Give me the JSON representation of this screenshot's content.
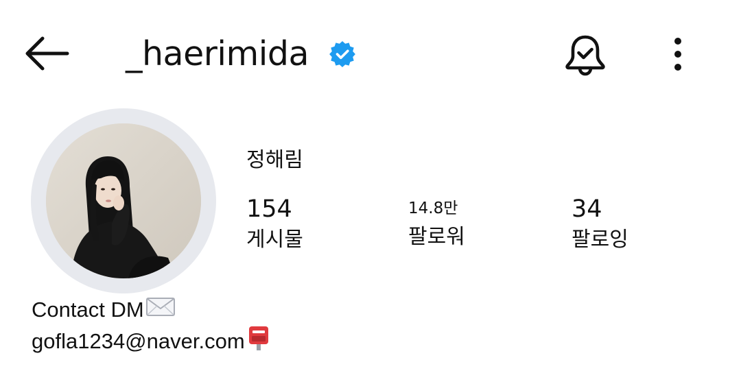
{
  "header": {
    "username": "_haerimida",
    "verified": true,
    "icons": {
      "back": "back-arrow-icon",
      "verified": "verified-badge-icon",
      "notifications": "notification-bell-check-icon",
      "more": "more-vertical-icon"
    }
  },
  "profile": {
    "display_name": "정해림",
    "avatar": "profile-photo"
  },
  "stats": {
    "posts": {
      "count": "154",
      "label": "게시물"
    },
    "followers": {
      "count": "14.8만",
      "label": "팔로워"
    },
    "following": {
      "count": "34",
      "label": "팔로잉"
    }
  },
  "bio": {
    "line1": "Contact DM",
    "line1_emoji": "envelope-icon",
    "line2": "gofla1234@naver.com",
    "line2_emoji": "postbox-icon"
  },
  "colors": {
    "verified": "#1d9bf0",
    "avatar_ring": "#e7e9ee",
    "postbox": "#e03a3e",
    "text": "#111111"
  }
}
